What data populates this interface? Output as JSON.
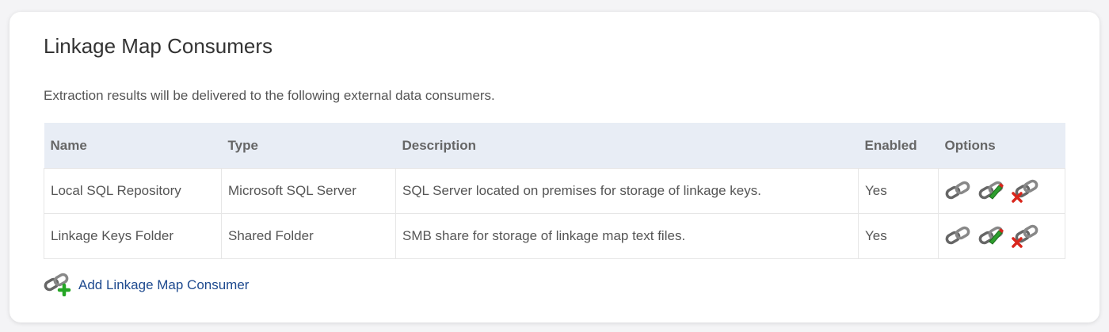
{
  "panel": {
    "title": "Linkage Map Consumers",
    "subtitle": "Extraction results will be delivered to the following external data consumers."
  },
  "table": {
    "headers": [
      "Name",
      "Type",
      "Description",
      "Enabled",
      "Options"
    ],
    "rows": [
      {
        "name": "Local SQL Repository",
        "type": "Microsoft SQL Server",
        "description": "SQL Server located on premises for storage of linkage keys.",
        "enabled": "Yes",
        "options": [
          "link-icon",
          "edit-link-icon",
          "delete-link-icon"
        ]
      },
      {
        "name": "Linkage Keys Folder",
        "type": "Shared Folder",
        "description": "SMB share for storage of linkage map text files.",
        "enabled": "Yes",
        "options": [
          "link-icon",
          "edit-link-icon",
          "delete-link-icon"
        ]
      }
    ]
  },
  "actions": {
    "add_label": "Add Linkage Map Consumer",
    "add_icon": "add-link-icon"
  },
  "colors": {
    "header_bg": "#e8edf5",
    "link": "#1e4a8f",
    "edit_accent": "#2e9e2e",
    "delete_accent": "#d9261c",
    "add_accent": "#25a625"
  }
}
